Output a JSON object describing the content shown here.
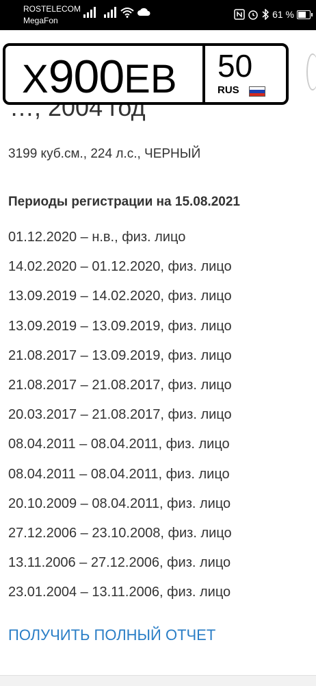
{
  "status_bar": {
    "carrier1": "ROSTELECOM",
    "carrier2": "MegaFon",
    "battery_text": "61 %",
    "icons": [
      "signal-icon",
      "signal-icon",
      "wifi-icon",
      "cloud-icon",
      "nfc-icon",
      "alarm-icon",
      "bluetooth-icon",
      "battery-icon"
    ]
  },
  "plate": {
    "letter1": "Х",
    "digits": "900",
    "letters": "ЕВ",
    "region": "50",
    "country": "RUS",
    "flag_colors": [
      "#ffffff",
      "#1c3fb0",
      "#d52b1e"
    ]
  },
  "vehicle": {
    "title_partial": "…, 2004 год",
    "specs": "3199 куб.см., 224 л.с., ЧЕРНЫЙ"
  },
  "registration": {
    "heading": "Периоды регистрации на 15.08.2021",
    "periods": [
      "01.12.2020 – н.в., физ. лицо",
      "14.02.2020 – 01.12.2020, физ. лицо",
      "13.09.2019 – 14.02.2020, физ. лицо",
      "13.09.2019 – 13.09.2019, физ. лицо",
      "21.08.2017 – 13.09.2019, физ. лицо",
      "21.08.2017 – 21.08.2017, физ. лицо",
      "20.03.2017 – 21.08.2017, физ. лицо",
      "08.04.2011 – 08.04.2011, физ. лицо",
      "08.04.2011 – 08.04.2011, физ. лицо",
      "20.10.2009 – 08.04.2011, физ. лицо",
      "27.12.2006 – 23.10.2008, физ. лицо",
      "13.11.2006 – 27.12.2006, физ. лицо",
      "23.01.2004 – 13.11.2006, физ. лицо"
    ]
  },
  "actions": {
    "full_report_label": "ПОЛУЧИТЬ ПОЛНЫЙ ОТЧЕТ",
    "link_color": "#2a7ec6"
  }
}
